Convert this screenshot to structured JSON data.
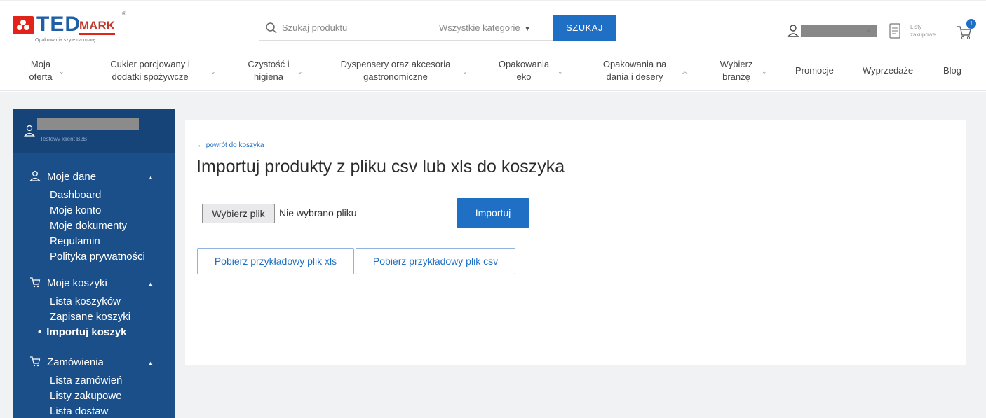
{
  "header": {
    "logo": {
      "ted": "TED",
      "mark": "MARK",
      "tagline": "Opakowania szyte na miarę",
      "reg": "®"
    },
    "search": {
      "placeholder": "Szukaj produktu",
      "category": "Wszystkie kategorie",
      "button": "SZUKAJ"
    },
    "lists_label": "Listy zakupowe",
    "cart_count": "1"
  },
  "nav": {
    "items": [
      {
        "label": "Moja\noferta"
      },
      {
        "label": "Cukier porcjowany i\ndodatki spożywcze"
      },
      {
        "label": "Czystość i\nhigiena"
      },
      {
        "label": "Dyspensery oraz akcesoria\ngastronomiczne"
      },
      {
        "label": "Opakowania\neko"
      },
      {
        "label": "Opakowania na\ndania i desery"
      },
      {
        "label": "Wybierz\nbranżę"
      },
      {
        "label": "Promocje"
      },
      {
        "label": "Wyprzedaże"
      },
      {
        "label": "Blog"
      }
    ]
  },
  "sidebar": {
    "role": "Testowy klient B2B",
    "sections": [
      {
        "title": "Moje dane",
        "links": [
          "Dashboard",
          "Moje konto",
          "Moje dokumenty",
          "Regulamin",
          "Polityka prywatności"
        ]
      },
      {
        "title": "Moje koszyki",
        "links": [
          "Lista koszyków",
          "Zapisane koszyki",
          "Importuj koszyk"
        ]
      },
      {
        "title": "Zamówienia",
        "links": [
          "Lista zamówień",
          "Listy zakupowe",
          "Lista dostaw"
        ]
      }
    ]
  },
  "main": {
    "back_link": "← powrót do koszyka",
    "title": "Importuj produkty z pliku csv lub xls do koszyka",
    "file_button": "Wybierz plik",
    "file_status": "Nie wybrano pliku",
    "import_button": "Importuj",
    "download_xls": "Pobierz przykładowy plik xls",
    "download_csv": "Pobierz przykładowy plik csv"
  },
  "colors": {
    "brand_blue": "#1f6fc5",
    "sidebar": "#1b4f8a",
    "logo_red": "#e2231a"
  }
}
